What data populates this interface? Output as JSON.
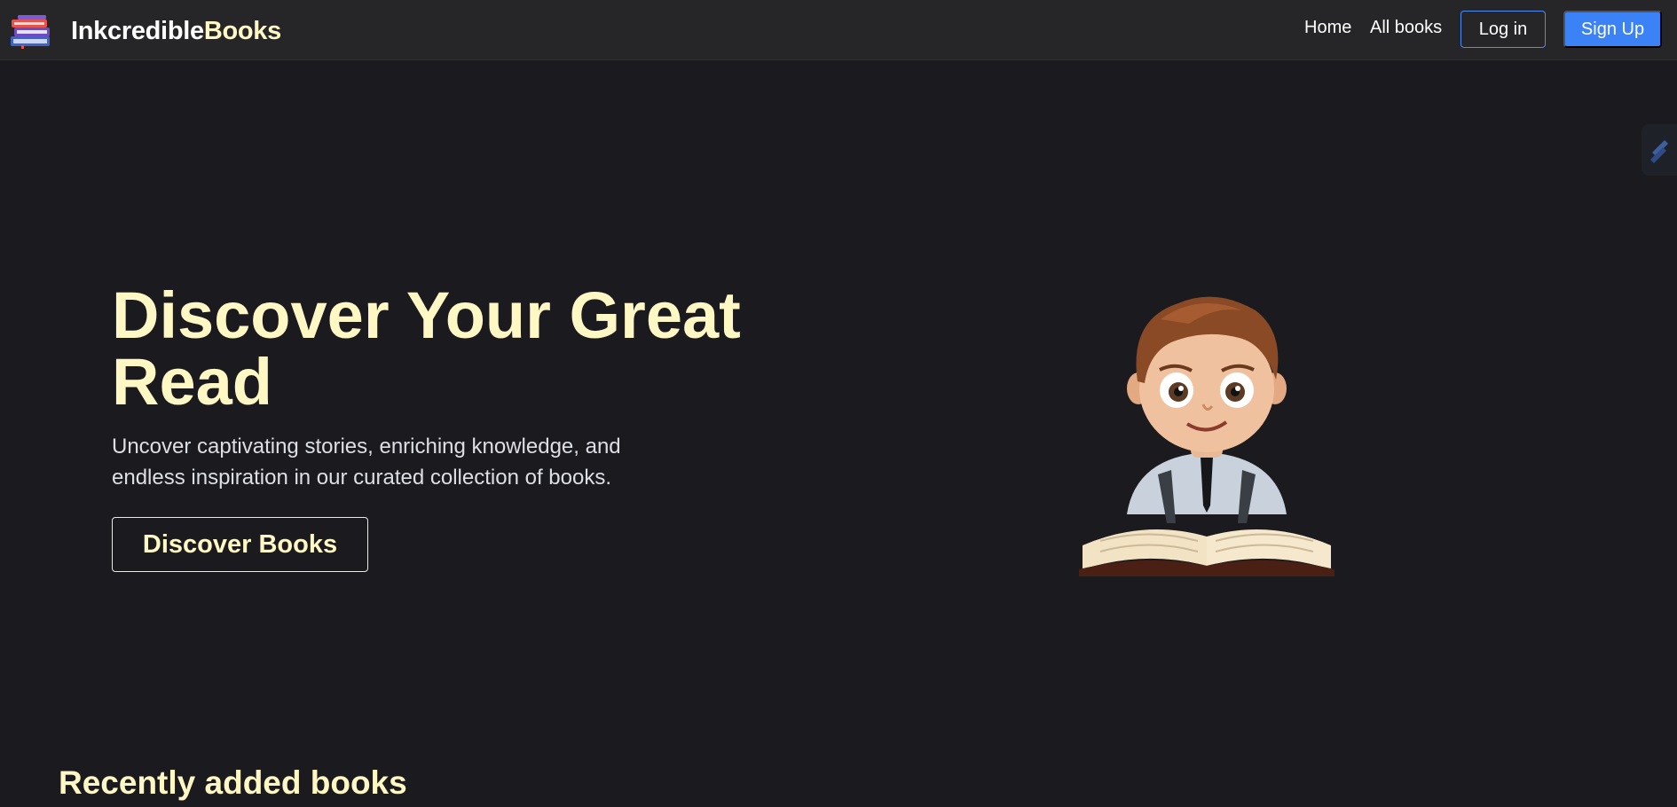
{
  "navbar": {
    "logo_icon": "book-stack-icon",
    "brand_part1": "Inkcredible",
    "brand_part2": "Books",
    "links": {
      "home": "Home",
      "all_books": "All books"
    },
    "login_label": "Log in",
    "signup_label": "Sign Up",
    "colors": {
      "brand_highlight": "#fff8c4",
      "primary": "#3b82f6",
      "background": "#262629"
    }
  },
  "side_widget": {
    "icon": "stripe-s-icon"
  },
  "hero": {
    "title": "Discover Your Great Read",
    "subtitle": "Uncover captivating stories, enriching knowledge, and endless inspiration in our curated collection of books.",
    "cta_label": "Discover Books",
    "illustration": "boy-reading-book-illustration"
  },
  "recent": {
    "title": "Recently added books"
  }
}
